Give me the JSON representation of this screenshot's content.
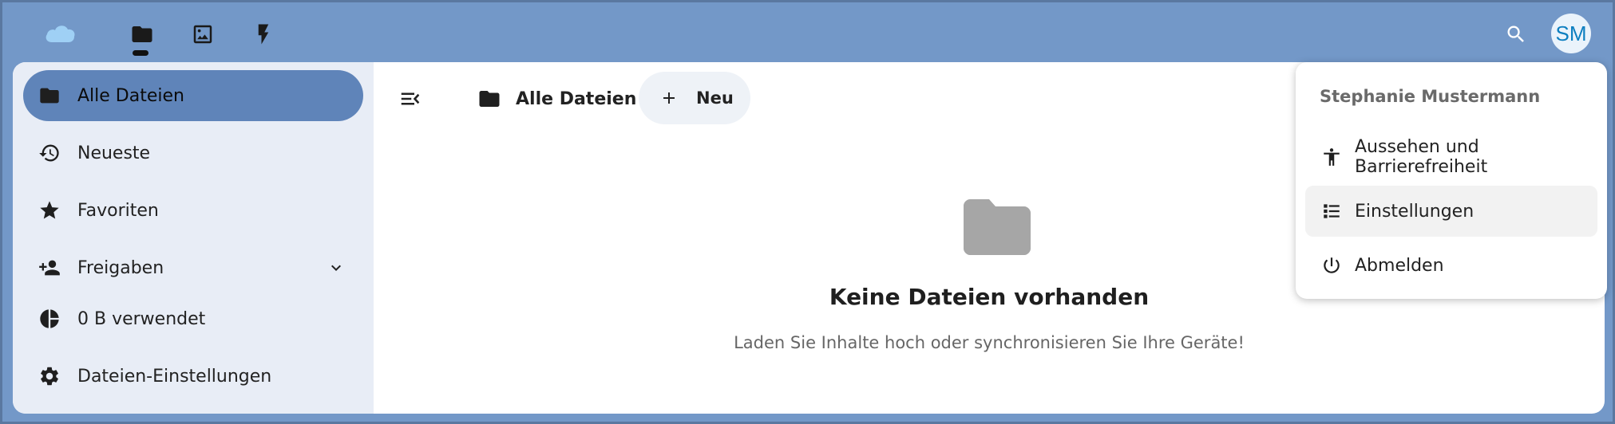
{
  "header": {
    "apps": [
      {
        "name": "files-app",
        "icon": "folder-icon"
      },
      {
        "name": "photos-app",
        "icon": "image-icon"
      },
      {
        "name": "activity-app",
        "icon": "lightning-icon"
      }
    ],
    "avatar_initials": "SM",
    "colors": {
      "header_bg": "#7398c8",
      "avatar_text": "#0d7fc0"
    }
  },
  "sidebar": {
    "items": [
      {
        "label": "Alle Dateien",
        "icon": "folder-icon",
        "active": true
      },
      {
        "label": "Neueste",
        "icon": "history-icon"
      },
      {
        "label": "Favoriten",
        "icon": "star-icon"
      },
      {
        "label": "Freigaben",
        "icon": "share-user-icon",
        "expandable": true
      },
      {
        "label": "0 B verwendet",
        "icon": "pie-chart-icon"
      },
      {
        "label": "Dateien-Einstellungen",
        "icon": "gear-icon"
      }
    ],
    "colors": {
      "active_bg": "#5f84b9",
      "sidebar_bg": "#e8edf6"
    }
  },
  "main": {
    "breadcrumb": "Alle Dateien",
    "new_button": "Neu",
    "empty_title": "Keine Dateien vorhanden",
    "empty_description": "Laden Sie Inhalte hoch oder synchronisieren Sie Ihre Geräte!"
  },
  "user_menu": {
    "name": "Stephanie Mustermann",
    "items": [
      {
        "label": "Aussehen und Barrierefreiheit",
        "icon": "accessibility-icon"
      },
      {
        "label": "Einstellungen",
        "icon": "settings-list-icon",
        "hovered": true
      },
      {
        "label": "Abmelden",
        "icon": "power-icon"
      }
    ]
  }
}
